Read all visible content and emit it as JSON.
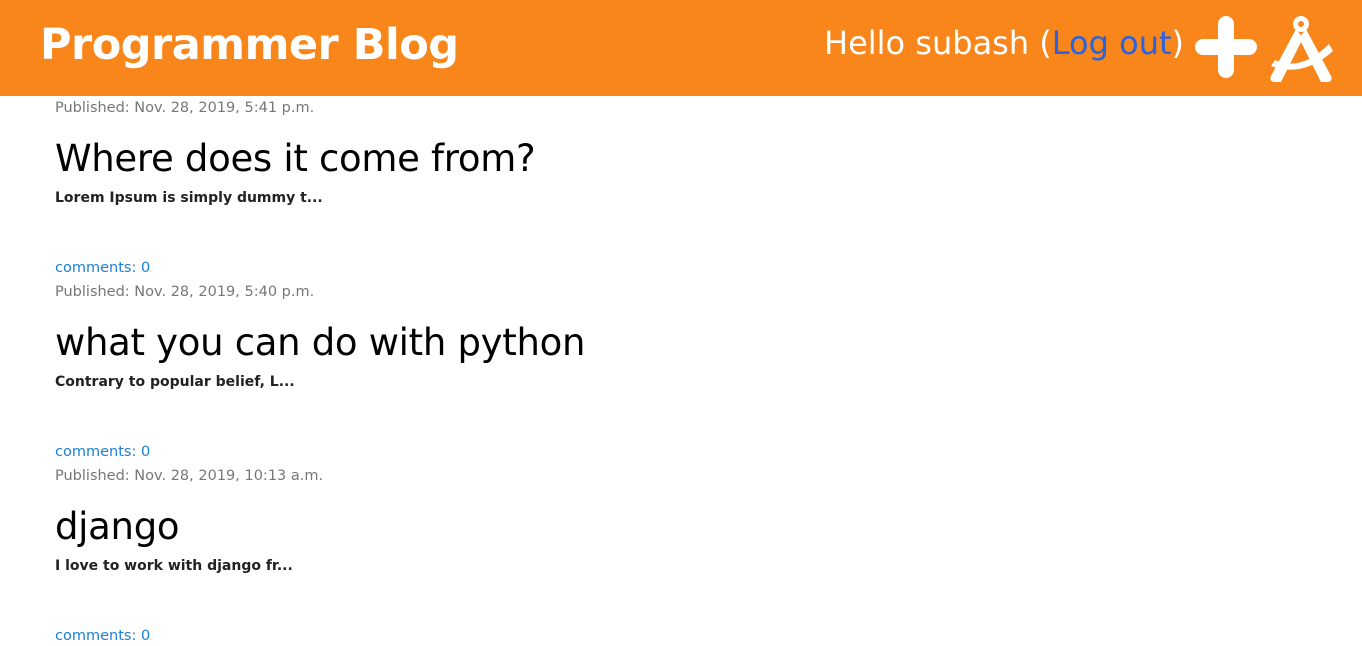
{
  "header": {
    "site_title": "Programmer Blog",
    "greeting": "Hello subash",
    "open_paren": "(",
    "logout_label": "Log out",
    "close_paren": ")",
    "new_post_icon": "plus-icon",
    "draft_icon": "compass-icon",
    "background_color": "#f8861a"
  },
  "posts": [
    {
      "published": "Published: Nov. 28, 2019, 5:41 p.m.",
      "title": "Where does it come from?",
      "excerpt": "Lorem Ipsum is simply dummy t...",
      "comments": "comments: 0"
    },
    {
      "published": "Published: Nov. 28, 2019, 5:40 p.m.",
      "title": "what you can do with python",
      "excerpt": "Contrary to popular belief, L...",
      "comments": "comments: 0"
    },
    {
      "published": "Published: Nov. 28, 2019, 10:13 a.m.",
      "title": "django",
      "excerpt": "I love to work with django fr...",
      "comments": "comments: 0"
    }
  ],
  "colors": {
    "link": "#1a7fd6",
    "date": "#777777",
    "logout": "#2a62e0"
  }
}
